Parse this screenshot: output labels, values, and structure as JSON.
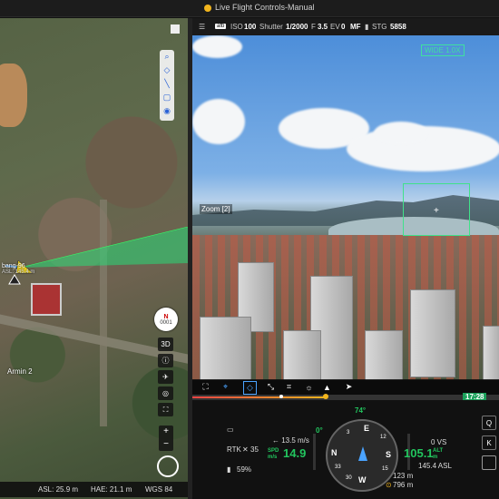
{
  "window": {
    "title": "Live Flight Controls-Manual"
  },
  "map": {
    "drone_label": "bang-96",
    "drone_asl": "ASL: 145.4 m",
    "home_label": "Armin 2",
    "compass_value": "0001",
    "compass_north": "N",
    "btn_3d": "3D",
    "footer": {
      "asl": "ASL: 25.9 m",
      "hae": "HAE: 21.1 m",
      "datum": "WGS 84"
    }
  },
  "camera": {
    "iso_label": "ISO",
    "iso_value": "100",
    "shutter_label": "Shutter",
    "shutter_value": "1/2000",
    "f_label": "F",
    "f_value": "3.5",
    "ev_label": "EV",
    "ev_value": "0",
    "focus": "MF",
    "storage_label": "STG",
    "storage_value": "5858",
    "auto_badge": "afb",
    "lens_mode": "WIDE 1.0X",
    "zoom_label": "Zoom [2]"
  },
  "timeline": {
    "time": "17:28"
  },
  "telemetry": {
    "rtk_label": "RTK",
    "satellites": "35",
    "battery": "59%",
    "hs_speed": "← 13.5 m/s",
    "spd_label": "SPD m/s",
    "speed": "14.9",
    "heading": "74°",
    "pitch": "0°",
    "vs": "0 VS",
    "alt": "105.1",
    "alt_label": "ALT m",
    "asl": "145.4 ASL",
    "dist": "123 m",
    "home_dist": "796 m",
    "compass_e": "E",
    "compass_n": "N",
    "compass_s": "S",
    "compass_w": "W",
    "compass_3": "3",
    "compass_12": "12",
    "compass_15": "15",
    "compass_33": "33",
    "compass_30": "30"
  },
  "side_buttons": {
    "q": "Q",
    "k": "K"
  },
  "colors": {
    "accent_green": "#22c55e",
    "accent_yellow": "#f2b51d",
    "accent_blue": "#2a62d6"
  }
}
